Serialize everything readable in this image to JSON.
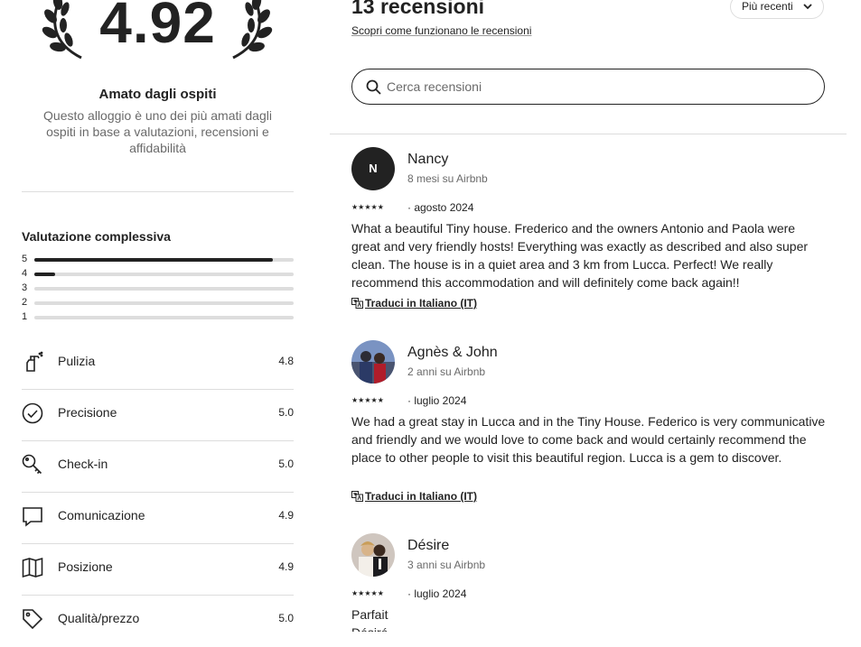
{
  "summary": {
    "score": "4.92",
    "favorite_title": "Amato dagli ospiti",
    "favorite_description": "Questo alloggio è uno dei più amati dagli ospiti in base a valutazioni, recensioni e affidabilità"
  },
  "overall": {
    "title": "Valutazione complessiva",
    "bars": [
      {
        "label": "5",
        "fraction": 0.92
      },
      {
        "label": "4",
        "fraction": 0.08
      },
      {
        "label": "3",
        "fraction": 0.0
      },
      {
        "label": "2",
        "fraction": 0.0
      },
      {
        "label": "1",
        "fraction": 0.0
      }
    ]
  },
  "categories": [
    {
      "label": "Pulizia",
      "value": "4.8",
      "icon": "spray-bottle-icon"
    },
    {
      "label": "Precisione",
      "value": "5.0",
      "icon": "check-circle-icon"
    },
    {
      "label": "Check-in",
      "value": "5.0",
      "icon": "key-icon"
    },
    {
      "label": "Comunicazione",
      "value": "4.9",
      "icon": "chat-bubble-icon"
    },
    {
      "label": "Posizione",
      "value": "4.9",
      "icon": "map-icon"
    },
    {
      "label": "Qualità/prezzo",
      "value": "5.0",
      "icon": "price-tag-icon"
    }
  ],
  "reviews_header": {
    "count": "13 recensioni",
    "how_it_works": "Scopri come funzionano le recensioni",
    "sort_label": "Più recenti",
    "search_placeholder": "Cerca recensioni"
  },
  "reviews": [
    {
      "initial": "N",
      "name": "Nancy",
      "meta": "8 mesi su Airbnb",
      "stars": "★★★★★",
      "date": "· agosto 2024",
      "text": "What a beautiful Tiny house. Frederico and the owners Antonio and Paola were great and very friendly hosts! Everything was exactly as described and also super clean. The house is in a quiet area and 3 km from Lucca. Perfect! We really recommend this accommodation and will definitely come back again!!",
      "translate": "Traduci in Italiano (IT)"
    },
    {
      "name": "Agnès & John",
      "meta": "2 anni su Airbnb",
      "stars": "★★★★★",
      "date": "· luglio 2024",
      "text": "We had a great stay in Lucca and in the Tiny House. Federico is very communicative and friendly and we would love to come back and  would certainly recommend the place to other people to visit this beautiful region. Lucca is a gem to discover.",
      "translate": "Traduci in Italiano (IT)"
    },
    {
      "name": "Désire",
      "meta": "3 anni su Airbnb",
      "stars": "★★★★★",
      "date": "· luglio 2024",
      "text": "Parfait",
      "text2": "Désiré"
    }
  ]
}
